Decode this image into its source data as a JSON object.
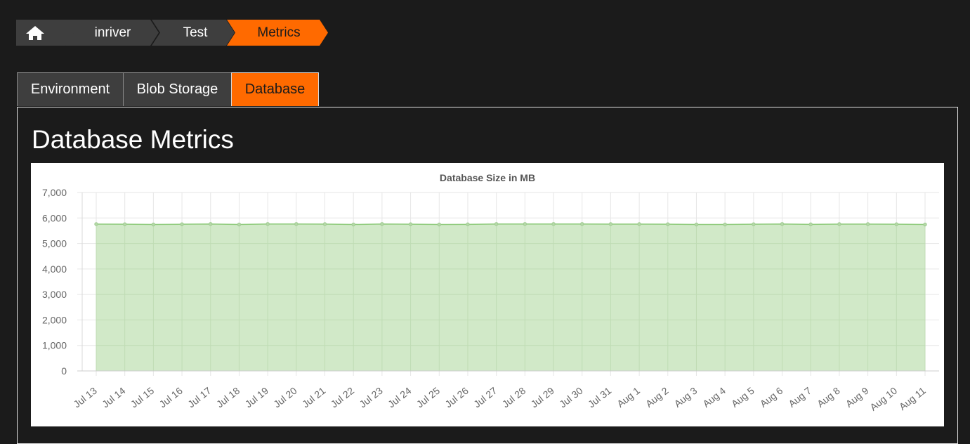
{
  "breadcrumb": {
    "home_icon": "home-icon",
    "items": [
      "inriver",
      "Test",
      "Metrics"
    ]
  },
  "tabs": [
    {
      "label": "Environment",
      "active": false
    },
    {
      "label": "Blob Storage",
      "active": false
    },
    {
      "label": "Database",
      "active": true
    }
  ],
  "page": {
    "title": "Database Metrics"
  },
  "colors": {
    "accent": "#ff6a00",
    "background": "#1b1b1b",
    "tab_bg": "#3e3e3e",
    "series_fill": "#d1e9c8",
    "series_line": "#8fcb7c"
  },
  "chart_data": {
    "type": "area",
    "title": "Database Size in MB",
    "xlabel": "",
    "ylabel": "",
    "ylim": [
      0,
      7000
    ],
    "yticks": [
      0,
      1000,
      2000,
      3000,
      4000,
      5000,
      6000,
      7000
    ],
    "ytick_labels": [
      "0",
      "1,000",
      "2,000",
      "3,000",
      "4,000",
      "5,000",
      "6,000",
      "7,000"
    ],
    "grid": true,
    "legend": "none",
    "categories": [
      "Jul 13",
      "Jul 14",
      "Jul 15",
      "Jul 16",
      "Jul 17",
      "Jul 18",
      "Jul 19",
      "Jul 20",
      "Jul 21",
      "Jul 22",
      "Jul 23",
      "Jul 24",
      "Jul 25",
      "Jul 26",
      "Jul 27",
      "Jul 28",
      "Jul 29",
      "Jul 30",
      "Jul 31",
      "Aug 1",
      "Aug 2",
      "Aug 3",
      "Aug 4",
      "Aug 5",
      "Aug 6",
      "Aug 7",
      "Aug 8",
      "Aug 9",
      "Aug 10",
      "Aug 11"
    ],
    "values": [
      5760,
      5755,
      5745,
      5755,
      5765,
      5745,
      5765,
      5765,
      5760,
      5745,
      5765,
      5755,
      5745,
      5750,
      5765,
      5765,
      5765,
      5765,
      5760,
      5760,
      5755,
      5745,
      5745,
      5755,
      5765,
      5750,
      5760,
      5760,
      5755,
      5745
    ]
  }
}
